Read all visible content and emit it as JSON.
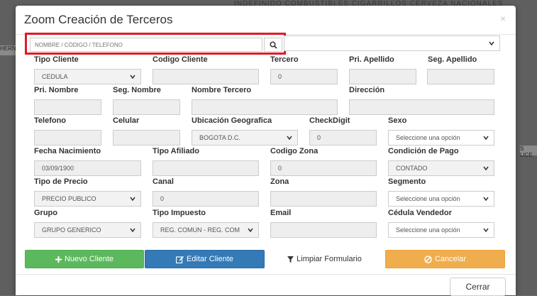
{
  "background": {
    "topbar_text": "INDEFINIDO  COMBUSTIBLES  CIGARRILLOS  CERVEZA NACIONALES",
    "left_text": "HERN",
    "right_text": "S LICE"
  },
  "modal": {
    "title": "Zoom Creación de Terceros",
    "close": "×"
  },
  "search": {
    "placeholder": "NOMBRE / CÓDIGO / TELEFONO"
  },
  "fields": {
    "tipo_cliente": {
      "label": "Tipo Cliente",
      "value": "CEDULA"
    },
    "codigo_cliente": {
      "label": "Codigo Cliente",
      "value": ""
    },
    "tercero": {
      "label": "Tercero",
      "value": "0"
    },
    "pri_apellido": {
      "label": "Pri. Apellido",
      "value": ""
    },
    "seg_apellido": {
      "label": "Seg. Apellido",
      "value": ""
    },
    "pri_nombre": {
      "label": "Pri. Nombre",
      "value": ""
    },
    "seg_nombre": {
      "label": "Seg. Nombre",
      "value": ""
    },
    "nombre_tercero": {
      "label": "Nombre Tercero",
      "value": ""
    },
    "direccion": {
      "label": "Dirección",
      "value": ""
    },
    "telefono": {
      "label": "Telefono",
      "value": ""
    },
    "celular": {
      "label": "Celular",
      "value": ""
    },
    "ubicacion": {
      "label": "Ubicación Geografica",
      "value": "BOGOTA D.C."
    },
    "checkdigit": {
      "label": "CheckDigit",
      "value": "0"
    },
    "sexo": {
      "label": "Sexo",
      "value": "Seleccione una opción"
    },
    "fecha_nacimiento": {
      "label": "Fecha Nacimiento",
      "value": "03/09/1900"
    },
    "tipo_afiliado": {
      "label": "Tipo Afiliado",
      "value": ""
    },
    "codigo_zona": {
      "label": "Codigo Zona",
      "value": "0"
    },
    "condicion_pago": {
      "label": "Condición de Pago",
      "value": "CONTADO"
    },
    "tipo_precio": {
      "label": "Tipo de Precio",
      "value": "PRECIO PUBLICO"
    },
    "canal": {
      "label": "Canal",
      "value": "0"
    },
    "zona": {
      "label": "Zona",
      "value": ""
    },
    "segmento": {
      "label": "Segmento",
      "value": "Seleccione una opción"
    },
    "grupo": {
      "label": "Grupo",
      "value": "GRUPO GENERICO"
    },
    "tipo_impuesto": {
      "label": "Tipo Impuesto",
      "value": "REG. COMUN - REG. COM"
    },
    "email": {
      "label": "Email",
      "value": ""
    },
    "cedula_vendedor": {
      "label": "Cédula Vendedor",
      "value": "Seleccione una opción"
    }
  },
  "buttons": {
    "nuevo": "Nuevo Cliente",
    "editar": "Editar Cliente",
    "limpiar": "Limpiar Formulario",
    "cancelar": "Cancelar",
    "cerrar": "Cerrar"
  },
  "colors": {
    "green": "#5cb85c",
    "blue": "#337ab7",
    "orange": "#f0ad4e",
    "highlight_red": "#e01b24"
  }
}
